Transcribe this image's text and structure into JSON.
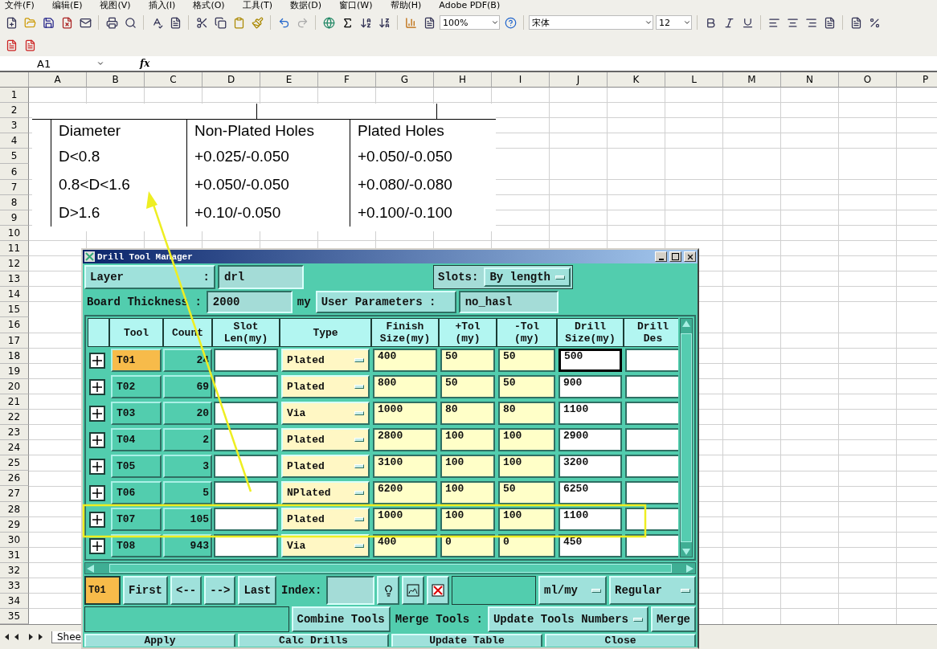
{
  "menu": [
    "文件(F)",
    "编辑(E)",
    "视图(V)",
    "插入(I)",
    "格式(O)",
    "工具(T)",
    "数据(D)",
    "窗口(W)",
    "帮助(H)",
    "Adobe PDF(B)"
  ],
  "toolbar": {
    "zoom": "100%",
    "font": "宋体",
    "font_size": "12"
  },
  "formula_bar": {
    "cell": "A1",
    "fx": "fx"
  },
  "columns": [
    "A",
    "B",
    "C",
    "D",
    "E",
    "F",
    "G",
    "H",
    "I",
    "J",
    "K",
    "L",
    "M",
    "N",
    "O",
    "P"
  ],
  "rows": [
    "1",
    "2",
    "3",
    "4",
    "5",
    "6",
    "7",
    "8",
    "9",
    "10",
    "11",
    "12",
    "13",
    "14",
    "15",
    "16",
    "17",
    "18",
    "19",
    "20",
    "21",
    "22",
    "23",
    "24",
    "25",
    "26",
    "27",
    "28",
    "29",
    "30",
    "31",
    "32",
    "33",
    "34",
    "35"
  ],
  "embedded_table": {
    "headers": [
      "Diameter",
      "Non-Plated Holes",
      "Plated Holes"
    ],
    "rows": [
      [
        "D<0.8",
        "+0.025/-0.050",
        "+0.050/-0.050"
      ],
      [
        "0.8<D<1.6",
        "+0.050/-0.050",
        "+0.080/-0.080"
      ],
      [
        "D>1.6",
        "+0.10/-0.050",
        "+0.100/-0.100"
      ]
    ]
  },
  "sheet_tab": "Shee",
  "dialog": {
    "title": "Drill Tool Manager",
    "layer": {
      "label": "Layer",
      "sep": ":",
      "value": "drl"
    },
    "slots": {
      "label": "Slots:",
      "value": "By length"
    },
    "thickness": {
      "label": "Board Thickness :",
      "value": "2000",
      "unit": "my"
    },
    "user_params": {
      "label": "User Parameters :",
      "value": "no_hasl"
    },
    "columns": [
      "Tool",
      "Count",
      "Slot Len(my)",
      "Type",
      "Finish Size(my)",
      "+Tol (my)",
      "-Tol (my)",
      "Drill Size(my)",
      "Drill Des"
    ],
    "rows": [
      {
        "tool": "T01",
        "count": "24",
        "type": "Plated",
        "finish": "400",
        "plus": "50",
        "minus": "50",
        "drill": "500",
        "selected": true,
        "focused": true
      },
      {
        "tool": "T02",
        "count": "69",
        "type": "Plated",
        "finish": "800",
        "plus": "50",
        "minus": "50",
        "drill": "900",
        "selected": false,
        "focused": false
      },
      {
        "tool": "T03",
        "count": "20",
        "type": "Via",
        "finish": "1000",
        "plus": "80",
        "minus": "80",
        "drill": "1100",
        "selected": false,
        "focused": false
      },
      {
        "tool": "T04",
        "count": "2",
        "type": "Plated",
        "finish": "2800",
        "plus": "100",
        "minus": "100",
        "drill": "2900",
        "selected": false,
        "focused": false
      },
      {
        "tool": "T05",
        "count": "3",
        "type": "Plated",
        "finish": "3100",
        "plus": "100",
        "minus": "100",
        "drill": "3200",
        "selected": false,
        "focused": false
      },
      {
        "tool": "T06",
        "count": "5",
        "type": "NPlated",
        "finish": "6200",
        "plus": "100",
        "minus": "50",
        "drill": "6250",
        "selected": false,
        "focused": false
      },
      {
        "tool": "T07",
        "count": "105",
        "type": "Plated",
        "finish": "1000",
        "plus": "100",
        "minus": "100",
        "drill": "1100",
        "selected": false,
        "focused": false
      },
      {
        "tool": "T08",
        "count": "943",
        "type": "Via",
        "finish": "400",
        "plus": "0",
        "minus": "0",
        "drill": "450",
        "selected": false,
        "focused": false
      }
    ],
    "current_tool": "T01",
    "nav": [
      "First",
      "<--",
      "-->",
      "Last"
    ],
    "index_label": "Index:",
    "units": "ml/my",
    "mode": "Regular",
    "combine": "Combine Tools",
    "merge_label": "Merge Tools :",
    "merge_mode": "Update Tools Numbers",
    "merge": "Merge",
    "actions": [
      "Apply",
      "Calc Drills",
      "Update Table",
      "Close"
    ]
  }
}
